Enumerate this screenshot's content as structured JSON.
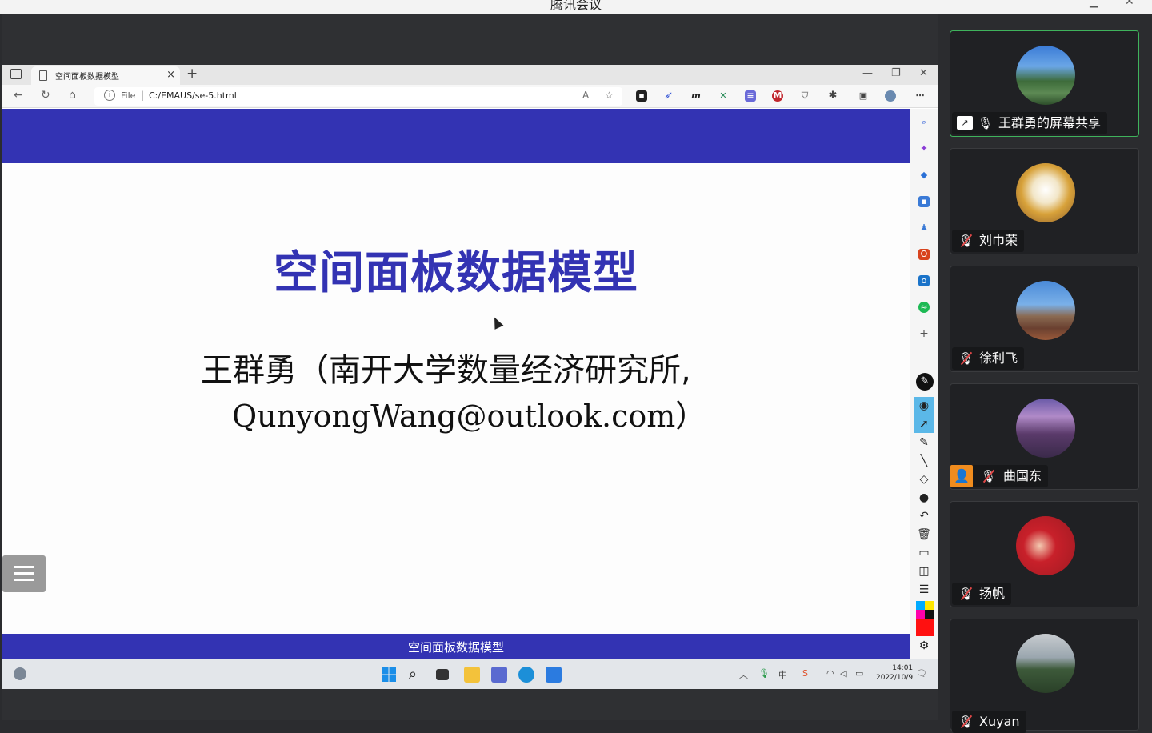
{
  "window": {
    "app_title": "腾讯会议"
  },
  "browser": {
    "tab_title": "空间面板数据模型",
    "address_scheme": "File",
    "address_url": "C:/EMAUS/se-5.html"
  },
  "slide": {
    "title": "空间面板数据模型",
    "author": "王群勇（南开大学数量经济研究所,",
    "email": "QunyongWang@outlook.com）",
    "footer": "空间面板数据模型"
  },
  "taskbar": {
    "time": "14:01",
    "date": "2022/10/9"
  },
  "participants": [
    {
      "name": "王群勇的屏幕共享",
      "mic": "on",
      "sharing": true
    },
    {
      "name": "刘巾荣",
      "mic": "muted"
    },
    {
      "name": "徐利飞",
      "mic": "muted"
    },
    {
      "name": "曲国东",
      "mic": "muted",
      "has_badge": true
    },
    {
      "name": "扬帆",
      "mic": "muted"
    },
    {
      "name": "Xuyan",
      "mic": "muted"
    }
  ],
  "colors": {
    "slide_accent": "#3333b3",
    "active_border": "#3fb35c"
  }
}
